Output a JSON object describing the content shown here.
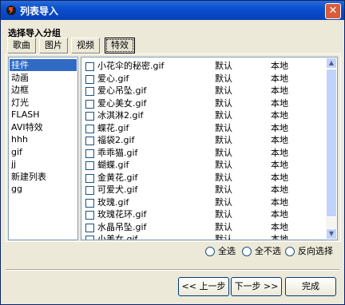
{
  "window": {
    "title": "列表导入",
    "close_glyph": "✕"
  },
  "section_title": "选择导入分组",
  "tabs": [
    {
      "label": "歌曲"
    },
    {
      "label": "图片"
    },
    {
      "label": "视频"
    },
    {
      "label": "特效",
      "active": true
    }
  ],
  "groups": [
    {
      "label": "挂件",
      "selected": true
    },
    {
      "label": "动画"
    },
    {
      "label": "边框"
    },
    {
      "label": "灯光"
    },
    {
      "label": "FLASH"
    },
    {
      "label": "AVI特效"
    },
    {
      "label": "hhh"
    },
    {
      "label": "gif"
    },
    {
      "label": "jj"
    },
    {
      "label": "新建列表"
    },
    {
      "label": "gg"
    }
  ],
  "files": [
    {
      "name": "小花伞的秘密.gif",
      "type": "默认",
      "source": "本地"
    },
    {
      "name": "爱心.gif",
      "type": "默认",
      "source": "本地"
    },
    {
      "name": "爱心吊坠.gif",
      "type": "默认",
      "source": "本地"
    },
    {
      "name": "爱心美女.gif",
      "type": "默认",
      "source": "本地"
    },
    {
      "name": "冰淇淋2.gif",
      "type": "默认",
      "source": "本地"
    },
    {
      "name": "蝶花.gif",
      "type": "默认",
      "source": "本地"
    },
    {
      "name": "福袋2.gif",
      "type": "默认",
      "source": "本地"
    },
    {
      "name": "乖乖猫.gif",
      "type": "默认",
      "source": "本地"
    },
    {
      "name": "蝴蝶.gif",
      "type": "默认",
      "source": "本地"
    },
    {
      "name": "金黄花.gif",
      "type": "默认",
      "source": "本地"
    },
    {
      "name": "可爱犬.gif",
      "type": "默认",
      "source": "本地"
    },
    {
      "name": "玫瑰.gif",
      "type": "默认",
      "source": "本地"
    },
    {
      "name": "玫瑰花环.gif",
      "type": "默认",
      "source": "本地"
    },
    {
      "name": "水晶吊坠.gif",
      "type": "默认",
      "source": "本地"
    },
    {
      "name": "小美女.gif",
      "type": "默认",
      "source": "本地"
    }
  ],
  "selection": {
    "all": "全选",
    "none": "全不选",
    "invert": "反向选择"
  },
  "buttons": {
    "prev": "<< 上一步",
    "next": "下一步 >>",
    "finish": "完成"
  },
  "colors": {
    "titlebar": "#0a4fcf",
    "selection": "#316ac5",
    "window_bg": "#ece9d8"
  }
}
